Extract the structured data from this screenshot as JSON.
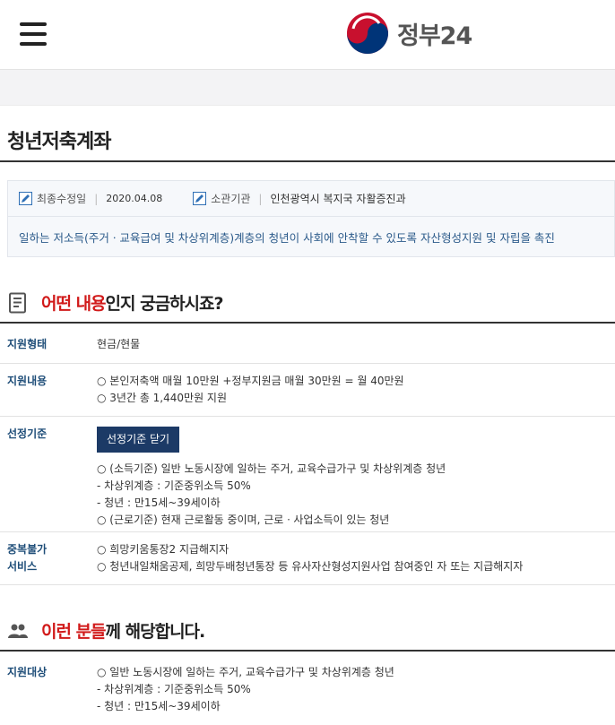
{
  "header": {
    "logo_text": "정부24",
    "menu_icon": "hamburger-menu-icon",
    "colors": {
      "logo_red": "#c8102e",
      "logo_blue": "#003478"
    }
  },
  "page": {
    "title": "청년저축계좌"
  },
  "info": {
    "modified_label": "최종수정일",
    "modified_value": "2020.04.08",
    "agency_label": "소관기관",
    "agency_value": "인천광역시 복지국 자활증진과",
    "description": "일하는 저소득(주거ㆍ교육급여 및 차상위계층)계층의 청년이 사회에 안착할 수 있도록 자산형성지원 및 자립을 촉진"
  },
  "section_what": {
    "title_red": "어떤 내용",
    "title_rest": "인지 궁금하시죠?",
    "icon": "document-list-icon"
  },
  "rows": {
    "support_type": {
      "label": "지원형태",
      "lines": [
        "현금/현물"
      ]
    },
    "support_content": {
      "label": "지원내용",
      "lines": [
        "○ 본인저축액 매월 10만원 +정부지원금 매월 30만원 = 월 40만원",
        "○ 3년간 총 1,440만원 지원"
      ]
    },
    "criteria": {
      "label": "선정기준",
      "button": "선정기준 닫기",
      "lines": [
        "○ (소득기준) 일반 노동시장에 일하는 주거, 교육수급가구 및 차상위계층 청년",
        " - 차상위계층 : 기준중위소득 50%",
        " - 청년 : 만15세~39세이하",
        "○ (근로기준) 현재 근로활동 중이며, 근로ㆍ사업소득이 있는 청년"
      ]
    },
    "duplicate": {
      "label_line1": "중복불가",
      "label_line2": "서비스",
      "lines": [
        "○ 희망키움통장2 지급해지자",
        "○ 청년내일채움공제, 희망두배청년통장 등 유사자산형성지원사업 참여중인 자 또는 지급해지자"
      ]
    }
  },
  "section_who": {
    "title_red": "이런 분들",
    "title_rest": "께 해당합니다.",
    "icon": "people-icon"
  },
  "target": {
    "label": "지원대상",
    "lines": [
      "○ 일반 노동시장에 일하는 주거, 교육수급가구 및 차상위계층 청년",
      " - 차상위계층 : 기준중위소득 50%",
      " - 청년 : 만15세~39세이하"
    ]
  }
}
